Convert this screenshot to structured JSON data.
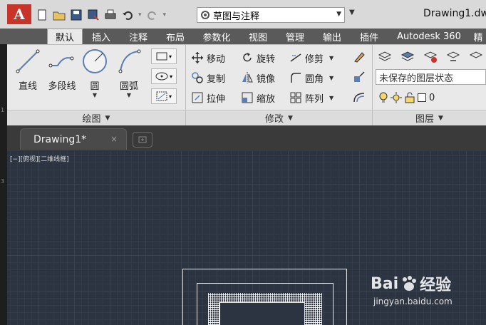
{
  "app": {
    "logo_letter": "A",
    "workspace": "草图与注释",
    "doc_title": "Drawing1.dw"
  },
  "ribbon_tabs": [
    "默认",
    "插入",
    "注释",
    "布局",
    "参数化",
    "视图",
    "管理",
    "输出",
    "插件",
    "Autodesk 360",
    "精"
  ],
  "draw_panel": {
    "tools": [
      "直线",
      "多段线",
      "圆",
      "圆弧"
    ],
    "footer": "绘图"
  },
  "modify_panel": {
    "rows": [
      [
        "移动",
        "旋转",
        "修剪"
      ],
      [
        "复制",
        "镜像",
        "圆角"
      ],
      [
        "拉伸",
        "缩放",
        "阵列"
      ]
    ],
    "footer": "修改"
  },
  "layer_panel": {
    "state": "未保存的图层状态",
    "current_layer": "0",
    "footer": "图层"
  },
  "file_tab": {
    "name": "Drawing1*",
    "close": "×"
  },
  "viewport": {
    "label": "[−][俯视][二维线框]"
  },
  "watermark": {
    "brand_left": "Bai",
    "brand_right": "经验",
    "url": "jingyan.baidu.com"
  },
  "colors": {
    "accent": "#c8342a",
    "canvas": "#2d3441",
    "ribbon_bg": "#e9e9e9",
    "tabbar_bg": "#5a5a5a"
  }
}
